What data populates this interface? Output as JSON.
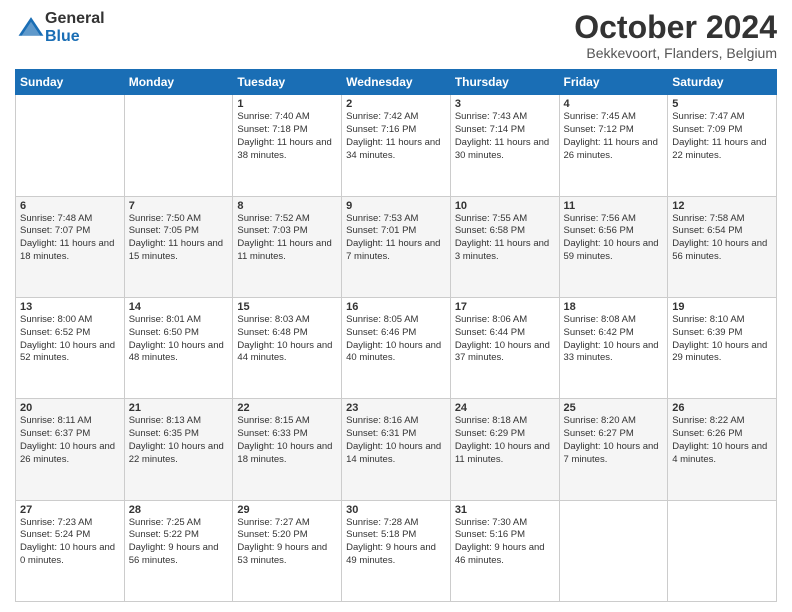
{
  "logo": {
    "general": "General",
    "blue": "Blue"
  },
  "header": {
    "month": "October 2024",
    "location": "Bekkevoort, Flanders, Belgium"
  },
  "weekdays": [
    "Sunday",
    "Monday",
    "Tuesday",
    "Wednesday",
    "Thursday",
    "Friday",
    "Saturday"
  ],
  "weeks": [
    [
      {
        "day": "",
        "info": ""
      },
      {
        "day": "",
        "info": ""
      },
      {
        "day": "1",
        "info": "Sunrise: 7:40 AM\nSunset: 7:18 PM\nDaylight: 11 hours and 38 minutes."
      },
      {
        "day": "2",
        "info": "Sunrise: 7:42 AM\nSunset: 7:16 PM\nDaylight: 11 hours and 34 minutes."
      },
      {
        "day": "3",
        "info": "Sunrise: 7:43 AM\nSunset: 7:14 PM\nDaylight: 11 hours and 30 minutes."
      },
      {
        "day": "4",
        "info": "Sunrise: 7:45 AM\nSunset: 7:12 PM\nDaylight: 11 hours and 26 minutes."
      },
      {
        "day": "5",
        "info": "Sunrise: 7:47 AM\nSunset: 7:09 PM\nDaylight: 11 hours and 22 minutes."
      }
    ],
    [
      {
        "day": "6",
        "info": "Sunrise: 7:48 AM\nSunset: 7:07 PM\nDaylight: 11 hours and 18 minutes."
      },
      {
        "day": "7",
        "info": "Sunrise: 7:50 AM\nSunset: 7:05 PM\nDaylight: 11 hours and 15 minutes."
      },
      {
        "day": "8",
        "info": "Sunrise: 7:52 AM\nSunset: 7:03 PM\nDaylight: 11 hours and 11 minutes."
      },
      {
        "day": "9",
        "info": "Sunrise: 7:53 AM\nSunset: 7:01 PM\nDaylight: 11 hours and 7 minutes."
      },
      {
        "day": "10",
        "info": "Sunrise: 7:55 AM\nSunset: 6:58 PM\nDaylight: 11 hours and 3 minutes."
      },
      {
        "day": "11",
        "info": "Sunrise: 7:56 AM\nSunset: 6:56 PM\nDaylight: 10 hours and 59 minutes."
      },
      {
        "day": "12",
        "info": "Sunrise: 7:58 AM\nSunset: 6:54 PM\nDaylight: 10 hours and 56 minutes."
      }
    ],
    [
      {
        "day": "13",
        "info": "Sunrise: 8:00 AM\nSunset: 6:52 PM\nDaylight: 10 hours and 52 minutes."
      },
      {
        "day": "14",
        "info": "Sunrise: 8:01 AM\nSunset: 6:50 PM\nDaylight: 10 hours and 48 minutes."
      },
      {
        "day": "15",
        "info": "Sunrise: 8:03 AM\nSunset: 6:48 PM\nDaylight: 10 hours and 44 minutes."
      },
      {
        "day": "16",
        "info": "Sunrise: 8:05 AM\nSunset: 6:46 PM\nDaylight: 10 hours and 40 minutes."
      },
      {
        "day": "17",
        "info": "Sunrise: 8:06 AM\nSunset: 6:44 PM\nDaylight: 10 hours and 37 minutes."
      },
      {
        "day": "18",
        "info": "Sunrise: 8:08 AM\nSunset: 6:42 PM\nDaylight: 10 hours and 33 minutes."
      },
      {
        "day": "19",
        "info": "Sunrise: 8:10 AM\nSunset: 6:39 PM\nDaylight: 10 hours and 29 minutes."
      }
    ],
    [
      {
        "day": "20",
        "info": "Sunrise: 8:11 AM\nSunset: 6:37 PM\nDaylight: 10 hours and 26 minutes."
      },
      {
        "day": "21",
        "info": "Sunrise: 8:13 AM\nSunset: 6:35 PM\nDaylight: 10 hours and 22 minutes."
      },
      {
        "day": "22",
        "info": "Sunrise: 8:15 AM\nSunset: 6:33 PM\nDaylight: 10 hours and 18 minutes."
      },
      {
        "day": "23",
        "info": "Sunrise: 8:16 AM\nSunset: 6:31 PM\nDaylight: 10 hours and 14 minutes."
      },
      {
        "day": "24",
        "info": "Sunrise: 8:18 AM\nSunset: 6:29 PM\nDaylight: 10 hours and 11 minutes."
      },
      {
        "day": "25",
        "info": "Sunrise: 8:20 AM\nSunset: 6:27 PM\nDaylight: 10 hours and 7 minutes."
      },
      {
        "day": "26",
        "info": "Sunrise: 8:22 AM\nSunset: 6:26 PM\nDaylight: 10 hours and 4 minutes."
      }
    ],
    [
      {
        "day": "27",
        "info": "Sunrise: 7:23 AM\nSunset: 5:24 PM\nDaylight: 10 hours and 0 minutes."
      },
      {
        "day": "28",
        "info": "Sunrise: 7:25 AM\nSunset: 5:22 PM\nDaylight: 9 hours and 56 minutes."
      },
      {
        "day": "29",
        "info": "Sunrise: 7:27 AM\nSunset: 5:20 PM\nDaylight: 9 hours and 53 minutes."
      },
      {
        "day": "30",
        "info": "Sunrise: 7:28 AM\nSunset: 5:18 PM\nDaylight: 9 hours and 49 minutes."
      },
      {
        "day": "31",
        "info": "Sunrise: 7:30 AM\nSunset: 5:16 PM\nDaylight: 9 hours and 46 minutes."
      },
      {
        "day": "",
        "info": ""
      },
      {
        "day": "",
        "info": ""
      }
    ]
  ]
}
